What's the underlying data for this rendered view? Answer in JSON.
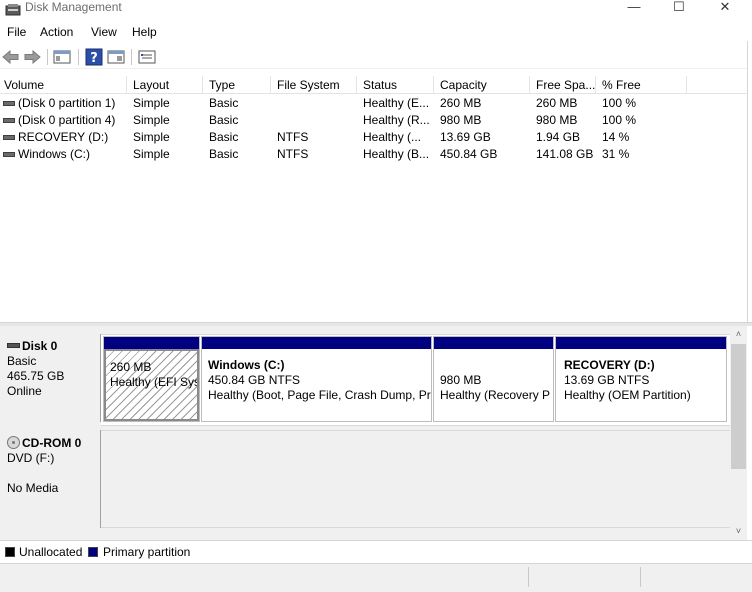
{
  "window": {
    "title": "Disk Management",
    "minimize_glyph": "—",
    "maximize_glyph": "☐",
    "close_glyph": "✕"
  },
  "menu": {
    "items": [
      {
        "label": "File"
      },
      {
        "label": "Action"
      },
      {
        "label": "View"
      },
      {
        "label": "Help"
      }
    ]
  },
  "toolbar": {
    "buttons": [
      {
        "icon": "back-arrow-icon"
      },
      {
        "icon": "forward-arrow-icon"
      },
      {
        "icon": "show-hide-console-tree-icon"
      },
      {
        "icon": "help-icon",
        "glyph": "?"
      },
      {
        "icon": "properties-icon"
      },
      {
        "icon": "export-list-icon"
      }
    ]
  },
  "volume_list": {
    "columns": [
      {
        "label": "Volume"
      },
      {
        "label": "Layout"
      },
      {
        "label": "Type"
      },
      {
        "label": "File System"
      },
      {
        "label": "Status"
      },
      {
        "label": "Capacity"
      },
      {
        "label": "Free Spa..."
      },
      {
        "label": "% Free"
      }
    ],
    "rows": [
      {
        "volume": "(Disk 0 partition 1)",
        "layout": "Simple",
        "type": "Basic",
        "fs": "",
        "status": "Healthy (E...",
        "capacity": "260 MB",
        "free": "260 MB",
        "pct": "100 %"
      },
      {
        "volume": "(Disk 0 partition 4)",
        "layout": "Simple",
        "type": "Basic",
        "fs": "",
        "status": "Healthy (R...",
        "capacity": "980 MB",
        "free": "980 MB",
        "pct": "100 %"
      },
      {
        "volume": "RECOVERY (D:)",
        "layout": "Simple",
        "type": "Basic",
        "fs": "NTFS",
        "status": "Healthy (...",
        "capacity": "13.69 GB",
        "free": "1.94 GB",
        "pct": "14 %"
      },
      {
        "volume": "Windows (C:)",
        "layout": "Simple",
        "type": "Basic",
        "fs": "NTFS",
        "status": "Healthy (B...",
        "capacity": "450.84 GB",
        "free": "141.08 GB",
        "pct": "31 %"
      }
    ]
  },
  "disks": {
    "disk0": {
      "name": "Disk 0",
      "type": "Basic",
      "size": "465.75 GB",
      "state": "Online",
      "partitions": {
        "efi": {
          "size": "260 MB",
          "status": "Healthy (EFI Sys"
        },
        "windows": {
          "name": "Windows  (C:)",
          "size": "450.84 GB NTFS",
          "status": "Healthy (Boot, Page File, Crash Dump, Pr"
        },
        "recovery_part": {
          "size": "980 MB",
          "status": "Healthy (Recovery P"
        },
        "recovery": {
          "name": "RECOVERY  (D:)",
          "size": "13.69 GB NTFS",
          "status": "Healthy (OEM Partition)"
        }
      }
    },
    "cdrom0": {
      "name": "CD-ROM 0",
      "drive": "DVD (F:)",
      "media": "No Media"
    }
  },
  "legend": {
    "unallocated": {
      "label": "Unallocated",
      "color": "#000000"
    },
    "primary": {
      "label": "Primary partition",
      "color": "#000080"
    }
  },
  "scrollbar": {
    "up_glyph": "˄",
    "down_glyph": "˅"
  }
}
